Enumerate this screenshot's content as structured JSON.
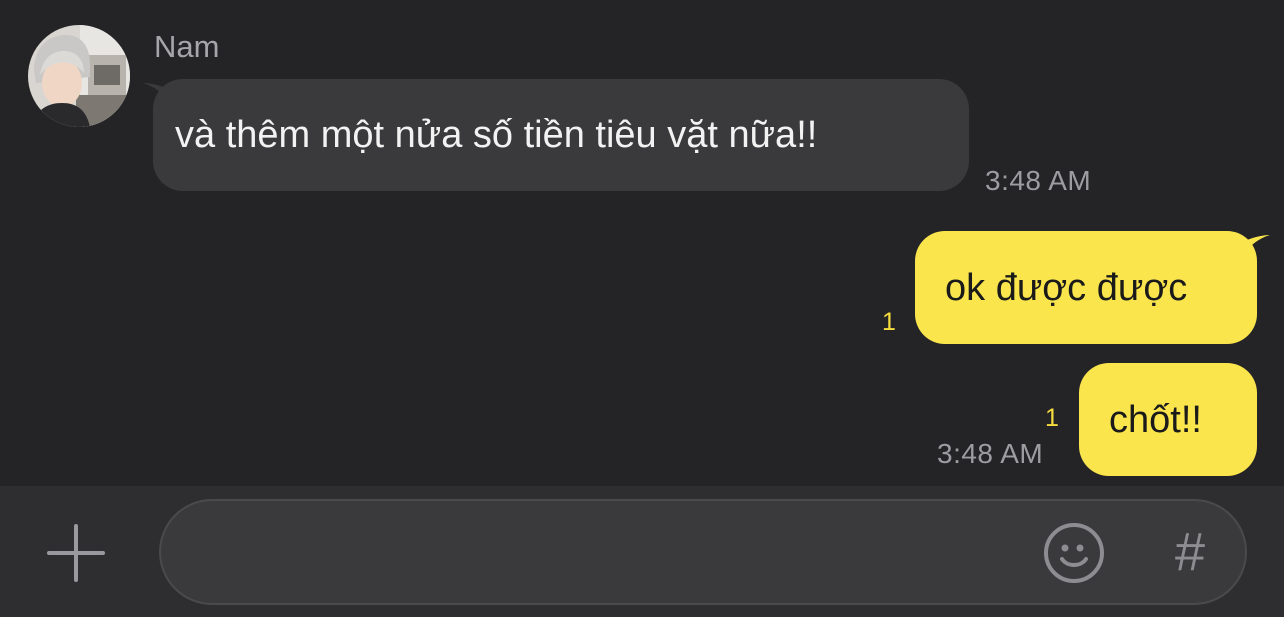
{
  "contact": {
    "name": "Nam",
    "avatar_icon": "profile-photo"
  },
  "messages": [
    {
      "direction": "incoming",
      "text": "và thêm một nửa số tiền tiêu vặt nữa!!",
      "time": "3:48 AM"
    },
    {
      "direction": "outgoing",
      "text": "ok được được",
      "unread_count": "1"
    },
    {
      "direction": "outgoing",
      "text": "chốt!!",
      "unread_count": "1",
      "time": "3:48 AM"
    }
  ],
  "input_bar": {
    "message_placeholder": "",
    "plus_icon": "plus-icon",
    "emoji_icon": "emoji-icon",
    "hash_label": "#"
  },
  "colors": {
    "background": "#242426",
    "incoming_bubble": "#3a3a3c",
    "outgoing_bubble": "#fae54d",
    "unread_accent": "#f7dd3d",
    "input_bar": "#2e2e30"
  }
}
